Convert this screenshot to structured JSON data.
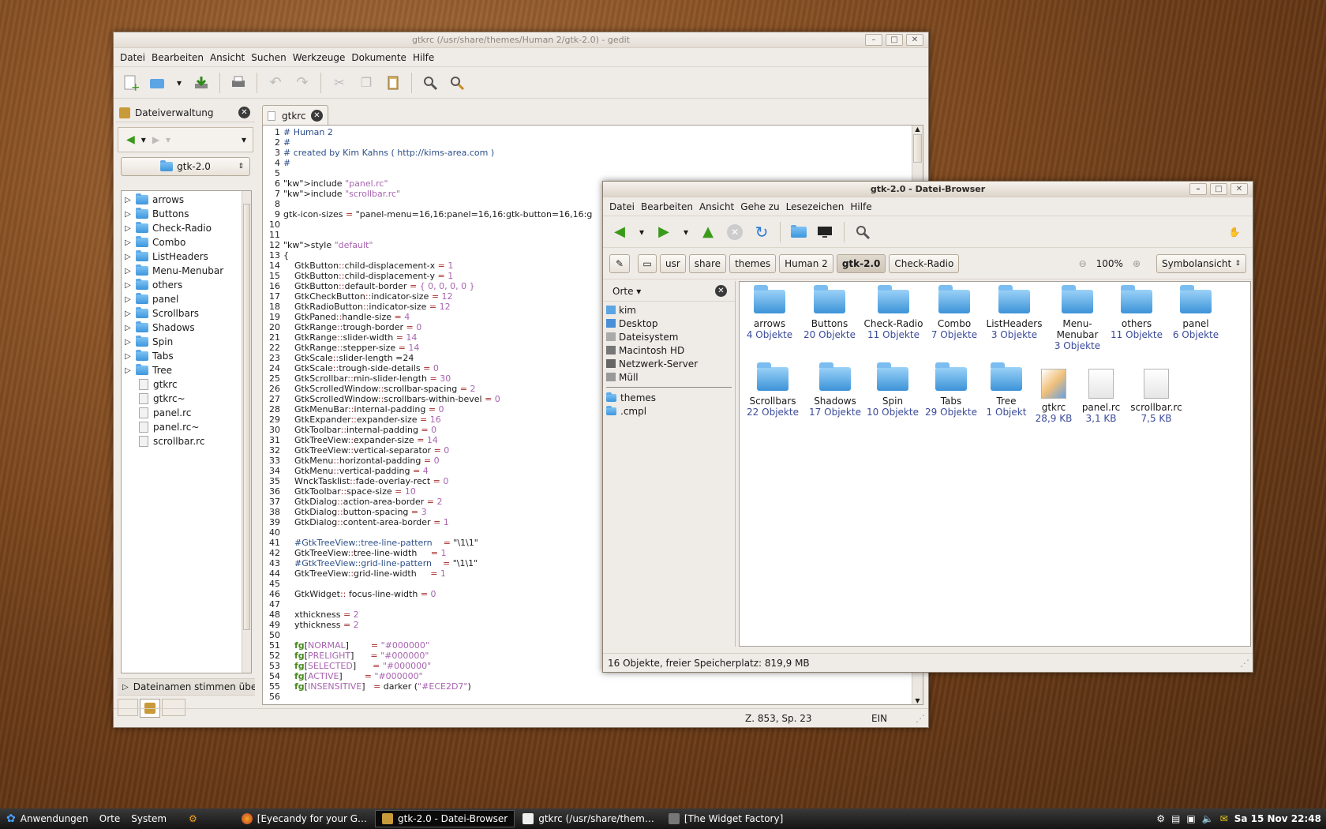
{
  "gedit": {
    "title": "gtkrc (/usr/share/themes/Human 2/gtk-2.0) - gedit",
    "menus": [
      "Datei",
      "Bearbeiten",
      "Ansicht",
      "Suchen",
      "Werkzeuge",
      "Dokumente",
      "Hilfe"
    ],
    "sidepanel_title": "Dateiverwaltung",
    "folder_combo": "gtk-2.0",
    "tree": [
      "arrows",
      "Buttons",
      "Check-Radio",
      "Combo",
      "ListHeaders",
      "Menu-Menubar",
      "others",
      "panel",
      "Scrollbars",
      "Shadows",
      "Spin",
      "Tabs",
      "Tree"
    ],
    "files": [
      "gtkrc",
      "gtkrc~",
      "panel.rc",
      "panel.rc~",
      "scrollbar.rc"
    ],
    "filter_label": "Dateinamen stimmen übere",
    "tab": "gtkrc",
    "status_pos": "Z. 853, Sp. 23",
    "status_mode": "EIN",
    "code": [
      "# Human 2",
      "#",
      "# created by Kim Kahns ( http://kims-area.com )",
      "#",
      "",
      "include \"panel.rc\"",
      "include \"scrollbar.rc\"",
      "",
      "gtk-icon-sizes = \"panel-menu=16,16:panel=16,16:gtk-button=16,16:g",
      "",
      "",
      "style \"default\"",
      "{",
      "    GtkButton::child-displacement-x = 1",
      "    GtkButton::child-displacement-y = 1",
      "    GtkButton::default-border = { 0, 0, 0, 0 }",
      "    GtkCheckButton::indicator-size = 12",
      "    GtkRadioButton::indicator-size = 12",
      "    GtkPaned::handle-size = 4",
      "    GtkRange::trough-border = 0",
      "    GtkRange::slider-width = 14",
      "    GtkRange::stepper-size = 14",
      "    GtkScale::slider-length =24",
      "    GtkScale::trough-side-details = 0",
      "    GtkScrollbar::min-slider-length = 30",
      "    GtkScrolledWindow::scrollbar-spacing = 2",
      "    GtkScrolledWindow::scrollbars-within-bevel = 0",
      "    GtkMenuBar::internal-padding = 0",
      "    GtkExpander::expander-size = 16",
      "    GtkToolbar::internal-padding = 0",
      "    GtkTreeView::expander-size = 14",
      "    GtkTreeView::vertical-separator = 0",
      "    GtkMenu::horizontal-padding = 0",
      "    GtkMenu::vertical-padding = 4",
      "    WnckTasklist::fade-overlay-rect = 0",
      "    GtkToolbar::space-size = 10",
      "    GtkDialog::action-area-border = 2",
      "    GtkDialog::button-spacing = 3",
      "    GtkDialog::content-area-border = 1",
      "",
      "    #GtkTreeView::tree-line-pattern    = \"\\1\\1\"",
      "    GtkTreeView::tree-line-width     = 1",
      "    #GtkTreeView::grid-line-pattern    = \"\\1\\1\"",
      "    GtkTreeView::grid-line-width     = 1",
      "",
      "    GtkWidget:: focus-line-width = 0",
      "",
      "    xthickness = 2",
      "    ythickness = 2",
      "",
      "    fg[NORMAL]        = \"#000000\"",
      "    fg[PRELIGHT]      = \"#000000\"",
      "    fg[SELECTED]      = \"#000000\"",
      "    fg[ACTIVE]        = \"#000000\"",
      "    fg[INSENSITIVE]   = darker (\"#ECE2D7\")",
      ""
    ]
  },
  "browser": {
    "title": "gtk-2.0 - Datei-Browser",
    "menus": [
      "Datei",
      "Bearbeiten",
      "Ansicht",
      "Gehe zu",
      "Lesezeichen",
      "Hilfe"
    ],
    "crumbs": [
      "usr",
      "share",
      "themes",
      "Human 2",
      "gtk-2.0",
      "Check-Radio"
    ],
    "zoom": "100%",
    "view": "Symbolansicht",
    "places_label": "Orte",
    "places": [
      "kim",
      "Desktop",
      "Dateisystem",
      "Macintosh HD",
      "Netzwerk-Server",
      "Müll"
    ],
    "bookmarks": [
      "themes",
      ".cmpl"
    ],
    "items": [
      {
        "name": "arrows",
        "sub": "4 Objekte",
        "kind": "folder"
      },
      {
        "name": "Buttons",
        "sub": "20 Objekte",
        "kind": "folder"
      },
      {
        "name": "Check-Radio",
        "sub": "11 Objekte",
        "kind": "folder"
      },
      {
        "name": "Combo",
        "sub": "7 Objekte",
        "kind": "folder"
      },
      {
        "name": "ListHeaders",
        "sub": "3 Objekte",
        "kind": "folder"
      },
      {
        "name": "Menu-Menubar",
        "sub": "3 Objekte",
        "kind": "folder"
      },
      {
        "name": "others",
        "sub": "11 Objekte",
        "kind": "folder"
      },
      {
        "name": "panel",
        "sub": "6 Objekte",
        "kind": "folder"
      },
      {
        "name": "Scrollbars",
        "sub": "22 Objekte",
        "kind": "folder"
      },
      {
        "name": "Shadows",
        "sub": "17 Objekte",
        "kind": "folder"
      },
      {
        "name": "Spin",
        "sub": "10 Objekte",
        "kind": "folder"
      },
      {
        "name": "Tabs",
        "sub": "29 Objekte",
        "kind": "folder"
      },
      {
        "name": "Tree",
        "sub": "1 Objekt",
        "kind": "folder"
      },
      {
        "name": "gtkrc",
        "sub": "28,9 KB",
        "kind": "gtkrc"
      },
      {
        "name": "panel.rc",
        "sub": "3,1 KB",
        "kind": "file"
      },
      {
        "name": "scrollbar.rc",
        "sub": "7,5 KB",
        "kind": "file"
      }
    ],
    "status": "16 Objekte, freier Speicherplatz: 819,9 MB"
  },
  "taskbar": {
    "menus": [
      "Anwendungen",
      "Orte",
      "System"
    ],
    "tasks": [
      "[Eyecandy for your G…",
      "gtk-2.0 - Datei-Browser",
      "gtkrc (/usr/share/them…",
      "[The Widget Factory]"
    ],
    "clock": "Sa 15 Nov 22:48"
  }
}
